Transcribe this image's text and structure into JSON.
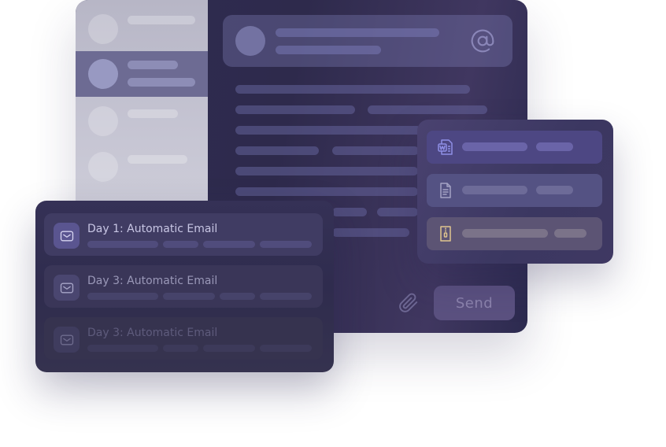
{
  "composer": {
    "send_label": "Send",
    "icons": {
      "mention": "at-sign-icon",
      "attach": "paperclip-icon"
    }
  },
  "attachments": {
    "files": [
      {
        "icon": "word-document-icon"
      },
      {
        "icon": "text-document-icon"
      },
      {
        "icon": "zip-file-icon"
      }
    ]
  },
  "sequence": {
    "items": [
      {
        "title": "Day 1: Automatic Email",
        "icon": "mail-icon"
      },
      {
        "title": "Day 3: Automatic Email",
        "icon": "mail-icon"
      },
      {
        "title": "Day 3: Automatic Email",
        "icon": "mail-icon"
      }
    ]
  },
  "colors": {
    "window_dark": "#2f2c52",
    "accent_purple": "#5b5180",
    "active_contact": "#6d6b93",
    "zip_accent": "#e0c58f",
    "word_accent": "#8f8fe6"
  }
}
